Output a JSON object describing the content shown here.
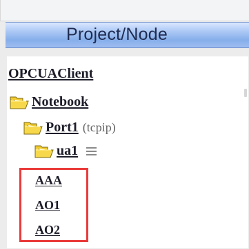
{
  "panel": {
    "title": "Project/Node"
  },
  "tree": {
    "root": {
      "label": "OPCUAClient"
    },
    "notebook": {
      "label": "Notebook",
      "icon": "folder-icon"
    },
    "port": {
      "label": "Port1",
      "protocol": "(tcpip)",
      "icon": "folder-icon"
    },
    "device": {
      "label": "ua1",
      "icon": "folder-icon",
      "menu_icon": "menu-icon"
    },
    "items": [
      {
        "label": "AAA"
      },
      {
        "label": "AO1"
      },
      {
        "label": "AO2"
      }
    ]
  },
  "colors": {
    "header_top": "#d9e6ff",
    "header_bottom": "#86aeea",
    "highlight": "#ea3a3a",
    "text": "#1d1d2a"
  }
}
